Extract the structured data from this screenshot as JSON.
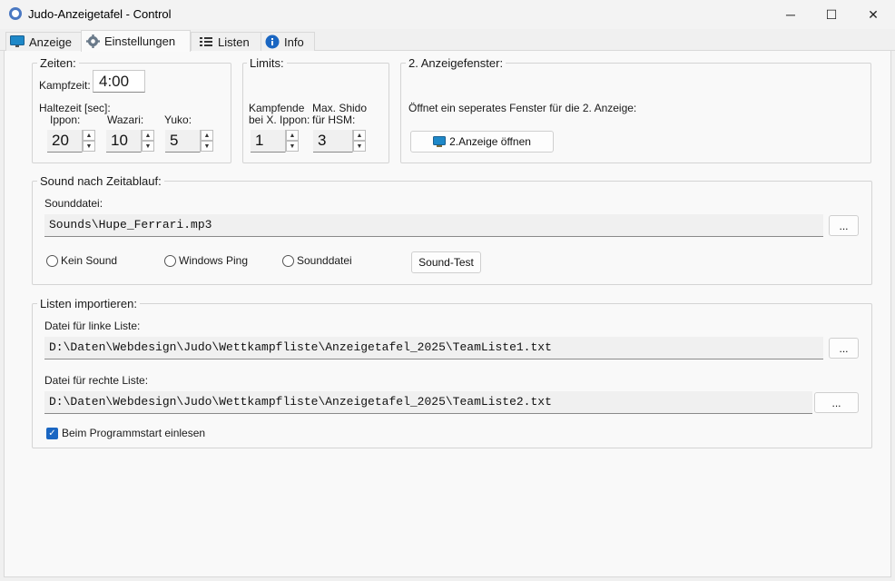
{
  "window": {
    "title": "Judo-Anzeigetafel - Control",
    "minimize": "─",
    "maximize": "☐",
    "close": "✕"
  },
  "tabs": [
    {
      "label": "Anzeige"
    },
    {
      "label": "Einstellungen"
    },
    {
      "label": "Listen"
    },
    {
      "label": "Info"
    }
  ],
  "zeiten": {
    "legend": "Zeiten:",
    "kampfzeit_label": "Kampfzeit:",
    "kampfzeit_value": "4:00",
    "haltezeit_label": "Haltezeit [sec]:",
    "ippon_label": "Ippon:",
    "ippon_value": "20",
    "wazari_label": "Wazari:",
    "wazari_value": "10",
    "yuko_label": "Yuko:",
    "yuko_value": "5"
  },
  "limits": {
    "legend": "Limits:",
    "kampfende_label_1": "Kampfende",
    "kampfende_label_2": "bei X. Ippon:",
    "kampfende_value": "1",
    "shido_label_1": "Max. Shido",
    "shido_label_2": "für HSM:",
    "shido_value": "3"
  },
  "anzeige2": {
    "legend": "2. Anzeigefenster:",
    "description": "Öffnet ein seperates Fenster für die 2. Anzeige:",
    "button_label": "2.Anzeige öffnen"
  },
  "sound": {
    "legend": "Sound nach Zeitablauf:",
    "file_label": "Sounddatei:",
    "file_value": "Sounds\\Hupe_Ferrari.mp3",
    "browse_label": "...",
    "option_none": "Kein Sound",
    "option_ping": "Windows Ping",
    "option_file": "Sounddatei",
    "test_button": "Sound-Test"
  },
  "listen": {
    "legend": "Listen importieren:",
    "left_label": "Datei für linke Liste:",
    "left_value": "D:\\Daten\\Webdesign\\Judo\\Wettkampfliste\\Anzeigetafel_2025\\TeamListe1.txt",
    "right_label": "Datei für rechte Liste:",
    "right_value": "D:\\Daten\\Webdesign\\Judo\\Wettkampfliste\\Anzeigetafel_2025\\TeamListe2.txt",
    "browse_label": "...",
    "startup_label": "Beim Programmstart einlesen",
    "startup_checked": true
  },
  "colors": {
    "accent": "#1a66c2",
    "info_icon": "#1a66c2",
    "monitor_icon": "#1e88c8"
  }
}
